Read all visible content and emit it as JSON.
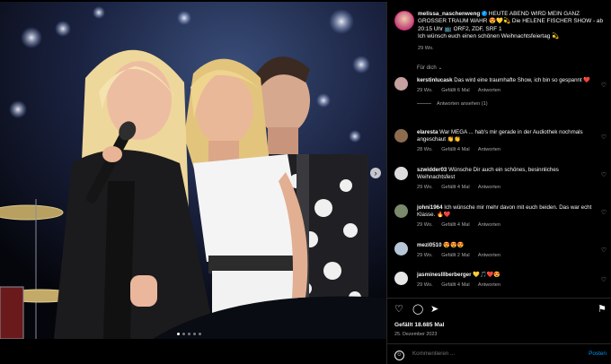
{
  "post": {
    "username": "melissa_naschenweng",
    "caption": "HEUTE ABEND WIRD MEIN GANZ GROSSER TRAUM WAHR 😍💛💫 Die HELENE FISCHER SHOW - ab 20:15 Uhr 📺 ORF2, ZDF, SRF 1",
    "caption2": "Ich wünsch euch einen schönen Weihnachtsfeiertag 💫",
    "age": "29 Wo.",
    "translate": "Für dich ⌄",
    "likes": "Gefällt 18.685 Mal",
    "date": "25. Dezember 2023"
  },
  "comments": [
    {
      "user": "kerstinlucask",
      "text": "Das wird eine traumhafte Show, ich bin so gespannt ❤️",
      "age": "29 Wo.",
      "likes": "Gefällt 6 Mal",
      "reply": "Antworten",
      "replies": "Antworten ansehen (1)",
      "color": "#c7a0a0"
    },
    {
      "user": "elaresta",
      "text": "War MEGA ... hab's mir gerade in der Audiothek nochmals angeschaut 👏👏",
      "age": "28 Wo.",
      "likes": "Gefällt 4 Mal",
      "reply": "Antworten",
      "color": "#8c6b4f"
    },
    {
      "user": "szwidder03",
      "text": "Wünsche Dir auch ein schönes, besinnliches Weihnachtsfest",
      "age": "29 Wo.",
      "likes": "Gefällt 4 Mal",
      "reply": "Antworten",
      "color": "#dcdcdc"
    },
    {
      "user": "johni1964",
      "text": "Ich wünsche mir mehr davon mit euch beiden. Das war echt Klasse. 🔥❤️",
      "age": "29 Wo.",
      "likes": "Gefällt 4 Mal",
      "reply": "Antworten",
      "color": "#7b8a6a"
    },
    {
      "user": "mezi0510",
      "text": "😍😍😍",
      "age": "29 Wo.",
      "likes": "Gefällt 2 Mal",
      "reply": "Antworten",
      "color": "#b6c6d6"
    },
    {
      "user": "jasmineslllberberger",
      "text": "💛🎵❤️😍",
      "age": "29 Wo.",
      "likes": "Gefällt 4 Mal",
      "reply": "Antworten",
      "color": "#e6e6e6"
    }
  ],
  "comment_box": {
    "placeholder": "Kommentieren ...",
    "post_label": "Posten"
  },
  "colors": {
    "accent": "#0095f6",
    "muted": "#a8a8a8"
  }
}
